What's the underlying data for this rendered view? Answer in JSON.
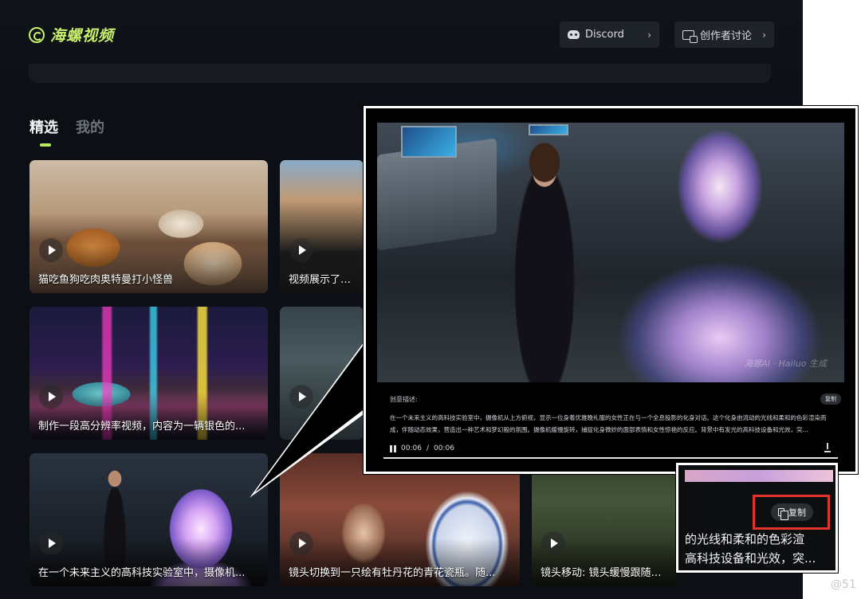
{
  "header": {
    "logo_text": "海螺视频",
    "discord_label": "Discord",
    "forum_label": "创作者讨论"
  },
  "tabs": [
    {
      "label": "精选",
      "active": true
    },
    {
      "label": "我的",
      "active": false
    }
  ],
  "cards": [
    {
      "caption": "猫吃鱼狗吃肉奥特曼打小怪兽"
    },
    {
      "caption": "视频展示了一个"
    },
    {
      "caption": "制作一段高分辨率视频，内容为一辆银色的..."
    },
    {
      "caption": ""
    },
    {
      "caption": "在一个未来主义的高科技实验室中，摄像机..."
    },
    {
      "caption": "镜头切换到一只绘有牡丹花的青花瓷瓶。随..."
    },
    {
      "caption": "镜头移动: 镜头缓慢跟随考古"
    }
  ],
  "detail": {
    "watermark": "海螺AI · Hailuo 生成",
    "description_title": "创意描述:",
    "description_text": "在一个未来主义的高科技实验室中，摄像机从上方俯视，显示一位身着优雅晚礼服的女性正在与一个全息投影的化身对话。这个化身由流动的光线和柔和的色彩渲染而成，伴随动态效果，营造出一种艺术和梦幻般的氛围。摄像机缓慢旋转，捕捉化身微妙的面部表情和女性惊艳的反应。背景中有发光的高科技设备和光效，突...",
    "copy_label": "复制",
    "time_current": "00:06",
    "time_separator": "/",
    "time_total": "00:06",
    "progress": 1.0
  },
  "inset": {
    "copy_label": "复制",
    "line1": "的光线和柔和的色彩渲",
    "line2": "高科技设备和光效，突..."
  },
  "site_mark": "@51"
}
